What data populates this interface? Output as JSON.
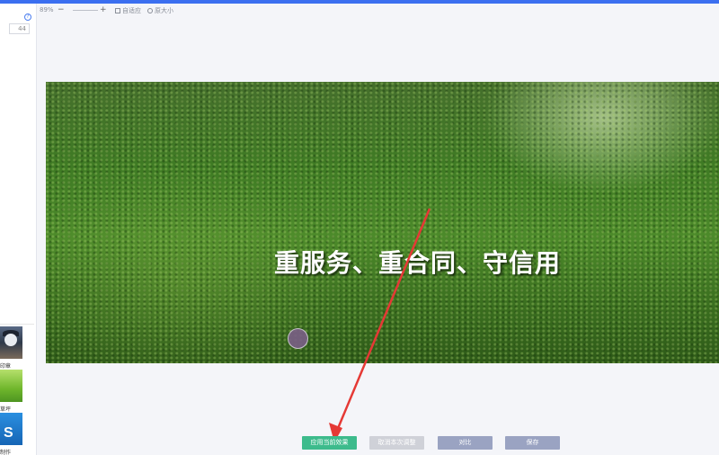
{
  "toolbar": {
    "zoom_percent": "89%",
    "zoom_minus": "−",
    "zoom_plus": "+",
    "fit_label": "自适应",
    "original_size_label": "原大小"
  },
  "left_panel": {
    "help": "?",
    "size_value": "44",
    "thumbnails": [
      {
        "label": "印章",
        "icon": "portrait-thumbnail"
      },
      {
        "label": "草坪",
        "icon": "lawn-thumbnail"
      },
      {
        "label": "制作",
        "icon": "ps-thumbnail"
      }
    ],
    "ps_text": "S"
  },
  "canvas": {
    "slogan": "重服务、重合同、守信用"
  },
  "buttons": {
    "apply": "应用当前效果",
    "cancel": "取消本次调整",
    "compare": "对比",
    "save": "保存"
  },
  "colors": {
    "top_bar": "#3b6ff0",
    "apply_button": "#3dbb8c",
    "secondary_button": "#9aa3c2",
    "arrow": "#e53935"
  }
}
